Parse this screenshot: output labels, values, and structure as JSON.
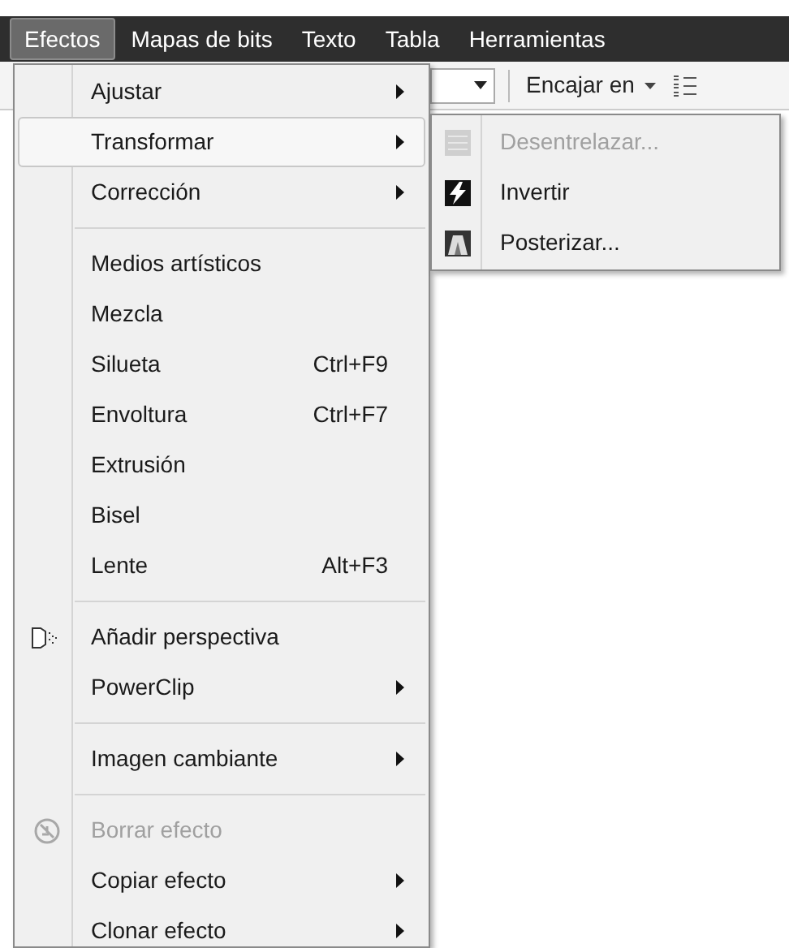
{
  "menubar": [
    {
      "label": "Efectos",
      "selected": true
    },
    {
      "label": "Mapas de bits",
      "selected": false
    },
    {
      "label": "Texto",
      "selected": false
    },
    {
      "label": "Tabla",
      "selected": false
    },
    {
      "label": "Herramientas",
      "selected": false
    }
  ],
  "toolbar": {
    "fit_label": "Encajar en"
  },
  "menu": [
    {
      "kind": "item",
      "label": "Ajustar",
      "has_submenu": true,
      "selected": false,
      "disabled": false
    },
    {
      "kind": "item",
      "label": "Transformar",
      "has_submenu": true,
      "selected": true,
      "disabled": false
    },
    {
      "kind": "item",
      "label": "Corrección",
      "has_submenu": true,
      "selected": false,
      "disabled": false
    },
    {
      "kind": "separator"
    },
    {
      "kind": "item",
      "label": "Medios artísticos",
      "has_submenu": false,
      "selected": false,
      "disabled": false
    },
    {
      "kind": "item",
      "label": "Mezcla",
      "has_submenu": false,
      "selected": false,
      "disabled": false
    },
    {
      "kind": "item",
      "label": "Silueta",
      "shortcut": "Ctrl+F9",
      "has_submenu": false,
      "selected": false,
      "disabled": false
    },
    {
      "kind": "item",
      "label": "Envoltura",
      "shortcut": "Ctrl+F7",
      "has_submenu": false,
      "selected": false,
      "disabled": false
    },
    {
      "kind": "item",
      "label": "Extrusión",
      "has_submenu": false,
      "selected": false,
      "disabled": false
    },
    {
      "kind": "item",
      "label": "Bisel",
      "has_submenu": false,
      "selected": false,
      "disabled": false
    },
    {
      "kind": "item",
      "label": "Lente",
      "shortcut": "Alt+F3",
      "has_submenu": false,
      "selected": false,
      "disabled": false
    },
    {
      "kind": "separator"
    },
    {
      "kind": "item",
      "label": "Añadir perspectiva",
      "has_submenu": false,
      "selected": false,
      "disabled": false
    },
    {
      "kind": "item",
      "label": "PowerClip",
      "has_submenu": true,
      "selected": false,
      "disabled": false
    },
    {
      "kind": "separator"
    },
    {
      "kind": "item",
      "label": "Imagen cambiante",
      "has_submenu": true,
      "selected": false,
      "disabled": false
    },
    {
      "kind": "separator"
    },
    {
      "kind": "item",
      "label": "Borrar efecto",
      "has_submenu": false,
      "selected": false,
      "disabled": true
    },
    {
      "kind": "item",
      "label": "Copiar efecto",
      "has_submenu": true,
      "selected": false,
      "disabled": false
    },
    {
      "kind": "item",
      "label": "Clonar efecto",
      "has_submenu": true,
      "selected": false,
      "disabled": false
    }
  ],
  "submenu": [
    {
      "label": "Desentrelazar...",
      "disabled": true
    },
    {
      "label": "Invertir",
      "disabled": false
    },
    {
      "label": "Posterizar...",
      "disabled": false
    }
  ]
}
